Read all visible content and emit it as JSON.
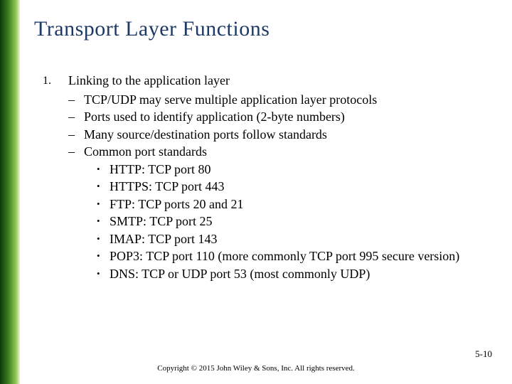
{
  "title": "Transport Layer Functions",
  "item_number": "1.",
  "item_heading": "Linking to the application layer",
  "dashes": [
    "TCP/UDP may serve multiple application layer protocols",
    "Ports used to identify application (2-byte numbers)",
    "Many source/destination ports follow standards",
    "Common port standards"
  ],
  "bullets": [
    "HTTP: TCP port 80",
    "HTTPS: TCP port 443",
    "FTP: TCP ports 20 and 21",
    "SMTP: TCP port 25",
    "IMAP: TCP port 143",
    "POP3: TCP port 110 (more commonly TCP port 995 secure version)",
    "DNS: TCP or UDP port 53 (most commonly UDP)"
  ],
  "footer": "Copyright © 2015 John Wiley & Sons, Inc. All rights reserved.",
  "page": "5-10"
}
